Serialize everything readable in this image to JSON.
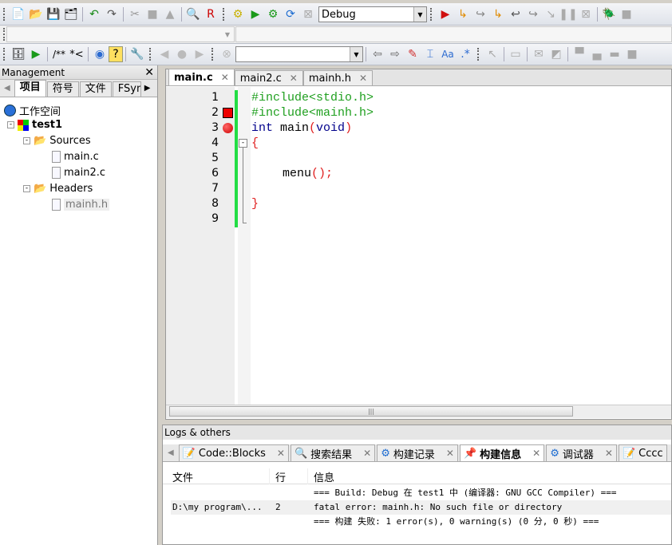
{
  "toolbar": {
    "build_target": "Debug",
    "comment_block": "/**",
    "comment_line": "*<"
  },
  "management": {
    "title": "Management",
    "tabs": [
      "项目",
      "符号",
      "文件",
      "FSym"
    ],
    "tree": {
      "workspace": "工作空间",
      "project": "test1",
      "sources": "Sources",
      "source_files": [
        "main.c",
        "main2.c"
      ],
      "headers": "Headers",
      "header_files": [
        "mainh.h"
      ]
    }
  },
  "editor": {
    "tabs": [
      "main.c",
      "main2.c",
      "mainh.h"
    ],
    "lines": [
      "1",
      "2",
      "3",
      "4",
      "5",
      "6",
      "7",
      "8",
      "9"
    ],
    "code": {
      "l1": "#include<stdio.h>",
      "l2": "#include<mainh.h>",
      "l3_kw": "int",
      "l3_name": " main",
      "l3_po": "(",
      "l3_void": "void",
      "l3_pc": ")",
      "l4": "{",
      "l6_name": "menu",
      "l6_op": "();",
      "l8": "}"
    },
    "scroll_grip": "|||"
  },
  "logs": {
    "title": "Logs & others",
    "tabs": [
      "Code::Blocks",
      "搜索结果",
      "构建记录",
      "构建信息",
      "调试器",
      "Cccc"
    ],
    "columns": [
      "文件",
      "行",
      "信息"
    ],
    "rows": [
      {
        "file": "",
        "line": "",
        "msg": "=== Build: Debug 在 test1 中 (编译器: GNU GCC Compiler) ==="
      },
      {
        "file": "D:\\my program\\...",
        "line": "2",
        "msg": "fatal error: mainh.h: No such file or directory"
      },
      {
        "file": "",
        "line": "",
        "msg": "=== 构建 失败: 1 error(s), 0 warning(s) (0 分, 0 秒) ==="
      }
    ]
  },
  "colors": {
    "accent_green": "#22dd44",
    "breakpoint": "#e00000"
  }
}
